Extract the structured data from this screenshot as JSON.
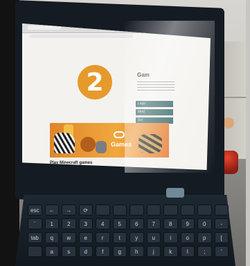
{
  "screen": {
    "step_number": "2",
    "banner_label": "Games",
    "caption_title": "Play Minecraft games",
    "sidebar_title": "Gam",
    "sidebar_buttons": [
      "Lego",
      "Mod",
      "Sci"
    ]
  },
  "keyboard": {
    "rows": [
      [
        "esc",
        "←",
        "→",
        "⟳",
        "",
        "",
        "",
        "",
        "",
        "",
        "",
        ""
      ],
      [
        "`",
        "1",
        "2",
        "3",
        "4",
        "5",
        "6",
        "7",
        "8",
        "9",
        "0",
        "-"
      ],
      [
        "tab",
        "q",
        "w",
        "e",
        "r",
        "t",
        "y",
        "u",
        "i",
        "o",
        "p",
        "["
      ],
      [
        "",
        "a",
        "s",
        "d",
        "f",
        "g",
        "h",
        "j",
        "k",
        "l",
        ";",
        "'"
      ]
    ]
  },
  "colors": {
    "badge": "#e69a2b",
    "banner": "#e0852a",
    "sidebar_button": "#2b5e5e"
  }
}
